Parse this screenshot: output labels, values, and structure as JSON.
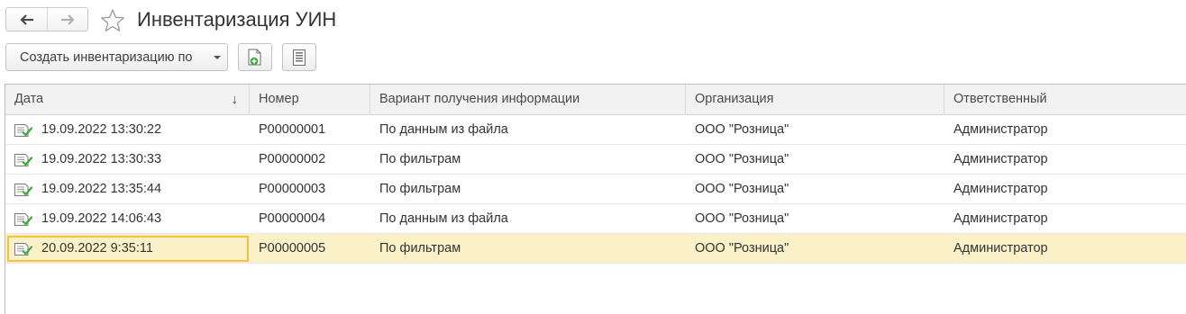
{
  "window": {
    "title": "Инвентаризация УИН",
    "back_icon": "arrow-left-icon",
    "forward_icon": "arrow-right-icon",
    "favorite_icon": "star-icon"
  },
  "toolbar": {
    "create_label": "Создать инвентаризацию по",
    "create_icon": "chevron-down-icon",
    "add_doc_icon": "add-document-icon",
    "report_icon": "report-icon"
  },
  "table": {
    "columns": [
      "Дата",
      "Номер",
      "Вариант получения информации",
      "Организация",
      "Ответственный"
    ],
    "sort_indicator": "↓",
    "rows": [
      {
        "date": "19.09.2022 13:30:22",
        "number": "Р00000001",
        "variant": "По данным из файла",
        "org": "ООО \"Розница\"",
        "responsible": "Администратор"
      },
      {
        "date": "19.09.2022 13:30:33",
        "number": "Р00000002",
        "variant": "По фильтрам",
        "org": "ООО \"Розница\"",
        "responsible": "Администратор"
      },
      {
        "date": "19.09.2022 13:35:44",
        "number": "Р00000003",
        "variant": "По фильтрам",
        "org": "ООО \"Розница\"",
        "responsible": "Администратор"
      },
      {
        "date": "19.09.2022 14:06:43",
        "number": "Р00000004",
        "variant": "По данным из файла",
        "org": "ООО \"Розница\"",
        "responsible": "Администратор"
      },
      {
        "date": "20.09.2022 9:35:11",
        "number": "Р00000005",
        "variant": "По фильтрам",
        "org": "ООО \"Розница\"",
        "responsible": "Администратор"
      }
    ],
    "selected_row": 4
  },
  "colors": {
    "selected_row": "#fbf1c8",
    "focus_border": "#f5c33b",
    "header_bg": "#f2f2f2",
    "posted_icon_green": "#3aa83a"
  }
}
